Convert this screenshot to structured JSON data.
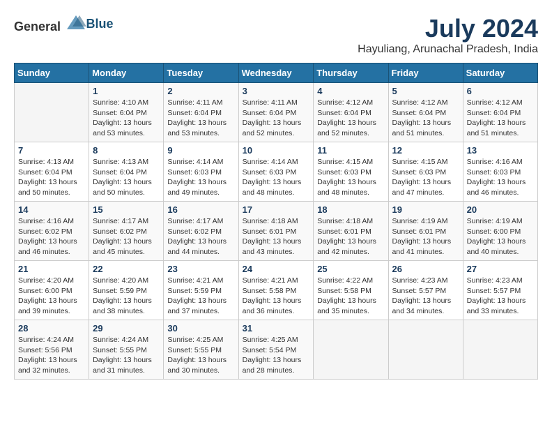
{
  "header": {
    "logo_general": "General",
    "logo_blue": "Blue",
    "title": "July 2024",
    "subtitle": "Hayuliang, Arunachal Pradesh, India"
  },
  "weekdays": [
    "Sunday",
    "Monday",
    "Tuesday",
    "Wednesday",
    "Thursday",
    "Friday",
    "Saturday"
  ],
  "weeks": [
    [
      {
        "day": "",
        "content": ""
      },
      {
        "day": "1",
        "content": "Sunrise: 4:10 AM\nSunset: 6:04 PM\nDaylight: 13 hours\nand 53 minutes."
      },
      {
        "day": "2",
        "content": "Sunrise: 4:11 AM\nSunset: 6:04 PM\nDaylight: 13 hours\nand 53 minutes."
      },
      {
        "day": "3",
        "content": "Sunrise: 4:11 AM\nSunset: 6:04 PM\nDaylight: 13 hours\nand 52 minutes."
      },
      {
        "day": "4",
        "content": "Sunrise: 4:12 AM\nSunset: 6:04 PM\nDaylight: 13 hours\nand 52 minutes."
      },
      {
        "day": "5",
        "content": "Sunrise: 4:12 AM\nSunset: 6:04 PM\nDaylight: 13 hours\nand 51 minutes."
      },
      {
        "day": "6",
        "content": "Sunrise: 4:12 AM\nSunset: 6:04 PM\nDaylight: 13 hours\nand 51 minutes."
      }
    ],
    [
      {
        "day": "7",
        "content": "Sunrise: 4:13 AM\nSunset: 6:04 PM\nDaylight: 13 hours\nand 50 minutes."
      },
      {
        "day": "8",
        "content": "Sunrise: 4:13 AM\nSunset: 6:04 PM\nDaylight: 13 hours\nand 50 minutes."
      },
      {
        "day": "9",
        "content": "Sunrise: 4:14 AM\nSunset: 6:03 PM\nDaylight: 13 hours\nand 49 minutes."
      },
      {
        "day": "10",
        "content": "Sunrise: 4:14 AM\nSunset: 6:03 PM\nDaylight: 13 hours\nand 48 minutes."
      },
      {
        "day": "11",
        "content": "Sunrise: 4:15 AM\nSunset: 6:03 PM\nDaylight: 13 hours\nand 48 minutes."
      },
      {
        "day": "12",
        "content": "Sunrise: 4:15 AM\nSunset: 6:03 PM\nDaylight: 13 hours\nand 47 minutes."
      },
      {
        "day": "13",
        "content": "Sunrise: 4:16 AM\nSunset: 6:03 PM\nDaylight: 13 hours\nand 46 minutes."
      }
    ],
    [
      {
        "day": "14",
        "content": "Sunrise: 4:16 AM\nSunset: 6:02 PM\nDaylight: 13 hours\nand 46 minutes."
      },
      {
        "day": "15",
        "content": "Sunrise: 4:17 AM\nSunset: 6:02 PM\nDaylight: 13 hours\nand 45 minutes."
      },
      {
        "day": "16",
        "content": "Sunrise: 4:17 AM\nSunset: 6:02 PM\nDaylight: 13 hours\nand 44 minutes."
      },
      {
        "day": "17",
        "content": "Sunrise: 4:18 AM\nSunset: 6:01 PM\nDaylight: 13 hours\nand 43 minutes."
      },
      {
        "day": "18",
        "content": "Sunrise: 4:18 AM\nSunset: 6:01 PM\nDaylight: 13 hours\nand 42 minutes."
      },
      {
        "day": "19",
        "content": "Sunrise: 4:19 AM\nSunset: 6:01 PM\nDaylight: 13 hours\nand 41 minutes."
      },
      {
        "day": "20",
        "content": "Sunrise: 4:19 AM\nSunset: 6:00 PM\nDaylight: 13 hours\nand 40 minutes."
      }
    ],
    [
      {
        "day": "21",
        "content": "Sunrise: 4:20 AM\nSunset: 6:00 PM\nDaylight: 13 hours\nand 39 minutes."
      },
      {
        "day": "22",
        "content": "Sunrise: 4:20 AM\nSunset: 5:59 PM\nDaylight: 13 hours\nand 38 minutes."
      },
      {
        "day": "23",
        "content": "Sunrise: 4:21 AM\nSunset: 5:59 PM\nDaylight: 13 hours\nand 37 minutes."
      },
      {
        "day": "24",
        "content": "Sunrise: 4:21 AM\nSunset: 5:58 PM\nDaylight: 13 hours\nand 36 minutes."
      },
      {
        "day": "25",
        "content": "Sunrise: 4:22 AM\nSunset: 5:58 PM\nDaylight: 13 hours\nand 35 minutes."
      },
      {
        "day": "26",
        "content": "Sunrise: 4:23 AM\nSunset: 5:57 PM\nDaylight: 13 hours\nand 34 minutes."
      },
      {
        "day": "27",
        "content": "Sunrise: 4:23 AM\nSunset: 5:57 PM\nDaylight: 13 hours\nand 33 minutes."
      }
    ],
    [
      {
        "day": "28",
        "content": "Sunrise: 4:24 AM\nSunset: 5:56 PM\nDaylight: 13 hours\nand 32 minutes."
      },
      {
        "day": "29",
        "content": "Sunrise: 4:24 AM\nSunset: 5:55 PM\nDaylight: 13 hours\nand 31 minutes."
      },
      {
        "day": "30",
        "content": "Sunrise: 4:25 AM\nSunset: 5:55 PM\nDaylight: 13 hours\nand 30 minutes."
      },
      {
        "day": "31",
        "content": "Sunrise: 4:25 AM\nSunset: 5:54 PM\nDaylight: 13 hours\nand 28 minutes."
      },
      {
        "day": "",
        "content": ""
      },
      {
        "day": "",
        "content": ""
      },
      {
        "day": "",
        "content": ""
      }
    ]
  ]
}
